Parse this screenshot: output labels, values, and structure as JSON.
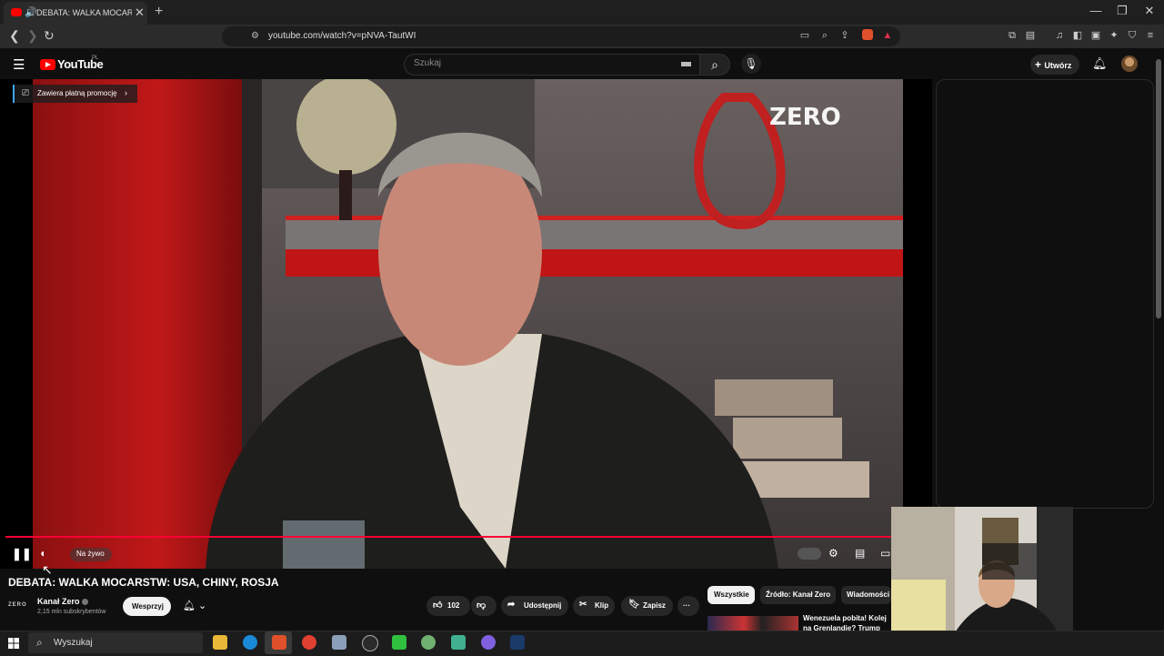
{
  "browser": {
    "tab_title": "DEBATA: WALKA MOCARSTW",
    "new_tab": "+",
    "close_tab": "✕",
    "url": "youtube.com/watch?v=pNVA-TautWI",
    "window_controls": [
      "—",
      "❐",
      "✕"
    ]
  },
  "youtube": {
    "logo_text": "YouTube",
    "country": "PL",
    "search_placeholder": "Szukaj",
    "create_label": "Utwórz"
  },
  "player": {
    "promo_label": "Zawiera płatną promocję",
    "live_label": "Na żywo",
    "progress": 1.0,
    "scene_logo": "ZERO"
  },
  "video": {
    "title": "DEBATA: WALKA MOCARSTW: USA, CHINY, ROSJA",
    "channel_logo": "ZERO",
    "channel_name": "Kanał Zero",
    "subscribers": "2,15 mln subskrybentów",
    "support_label": "Wesprzyj",
    "likes": "102",
    "share_label": "Udostępnij",
    "clip_label": "Klip",
    "save_label": "Zapisz",
    "more_label": "···"
  },
  "filters": [
    "Wszystkie",
    "Źródło: Kanał Zero",
    "Wiadomości"
  ],
  "recommendation": {
    "title": "Wenezuela pobita! Kolej na Grenlandię? Trump bezwz"
  },
  "taskbar": {
    "search_placeholder": "Wyszukaj"
  },
  "colors": {
    "accent_red": "#ff0033",
    "youtube_red": "#ff0000",
    "background": "#0f0f0f"
  }
}
